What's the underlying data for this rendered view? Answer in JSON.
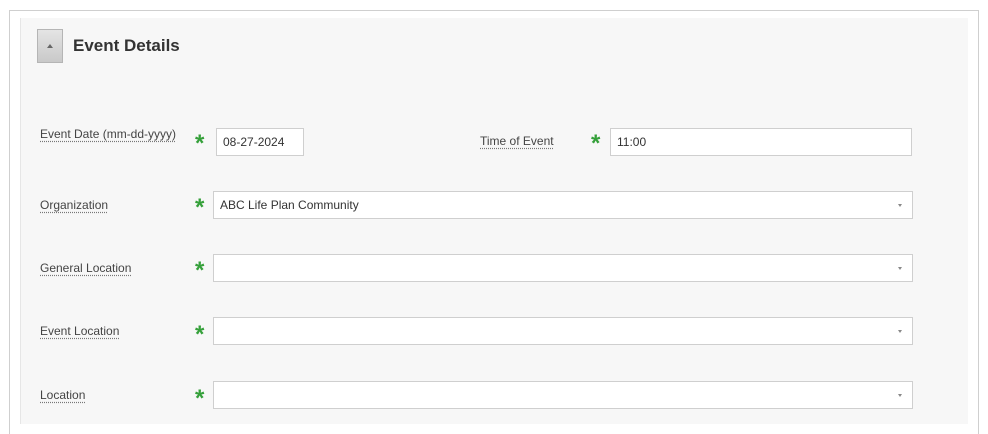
{
  "section": {
    "title": "Event Details"
  },
  "fields": {
    "event_date": {
      "label": "Event Date (mm-dd-yyyy)",
      "value": "08-27-2024"
    },
    "time_of_event": {
      "label": "Time of Event",
      "value": "11:00"
    },
    "organization": {
      "label": "Organization",
      "value": "ABC Life Plan Community"
    },
    "general_location": {
      "label": "General Location",
      "value": ""
    },
    "event_location": {
      "label": "Event Location",
      "value": ""
    },
    "location": {
      "label": "Location",
      "value": ""
    }
  },
  "required_marker": "*",
  "colors": {
    "required": "#35a03a",
    "panel_bg": "#f7f7f7",
    "field_border": "#cfcfcf"
  },
  "icons": {
    "toggle": "caret-up-icon",
    "select": "chevron-down-icon"
  }
}
